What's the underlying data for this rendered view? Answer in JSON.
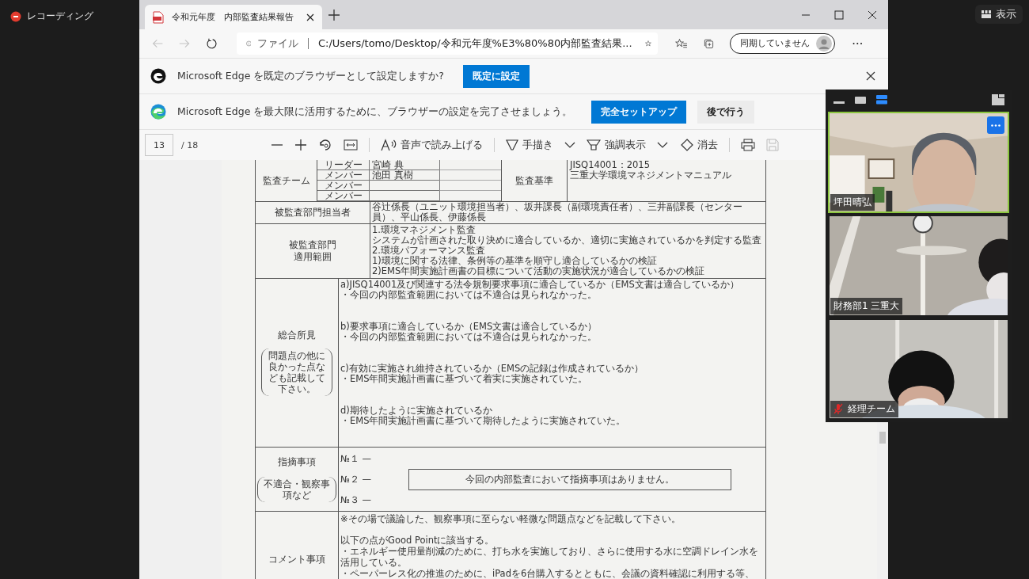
{
  "recording": {
    "label": "レコーディング"
  },
  "view_button": {
    "label": "表示"
  },
  "browser": {
    "tabs": [
      {
        "title": "令和元年度　内部監査結果報告",
        "selected": true
      }
    ],
    "nav_buttons": [
      {
        "kind": "back",
        "disabled": true
      },
      {
        "kind": "forward",
        "disabled": true
      },
      {
        "kind": "refresh",
        "disabled": false
      }
    ],
    "address": {
      "scheme": "ファイル",
      "url": "C:/Users/tomo/Desktop/令和元年度%E3%80%80内部監査結果..."
    },
    "profile": {
      "label": "同期していません"
    },
    "infobars": [
      {
        "message": "Microsoft Edge を既定のブラウザーとして設定しますか?",
        "buttons": [
          {
            "label": "既定に設定",
            "kind": "primary"
          }
        ],
        "closable": true
      },
      {
        "message": "Microsoft Edge を最大限に活用するために、ブラウザーの設定を完了させましょう。",
        "buttons": [
          {
            "label": "完全セットアップ",
            "kind": "primary"
          },
          {
            "label": "後で行う",
            "kind": "secondary"
          }
        ]
      }
    ],
    "pdf_toolbar": {
      "page": "13",
      "total": "/ 18",
      "read_aloud": "音声で読み上げる",
      "draw": "手描き",
      "highlight": "強調表示",
      "erase": "消去"
    }
  },
  "document": {
    "team": {
      "label": "監査チーム",
      "members": [
        {
          "role": "リーダー",
          "name": "宮崎 典"
        },
        {
          "role": "メンバー",
          "name": "池田 真樹"
        },
        {
          "role": "メンバー"
        },
        {
          "role": "メンバー"
        }
      ],
      "criteria_label": "監査基準",
      "criteria": [
        "JISQ14001：2015",
        "三重大学環境マネジメントマニュアル"
      ]
    },
    "contacts": {
      "label": "被監査部門担当者",
      "text": "谷辻係長（ユニット環境担当者）、坂井課長（副環境責任者）、三井副課長（センター員）、平山係長、伊藤係長"
    },
    "scope": {
      "label": [
        "被監査部門",
        "適用範囲"
      ],
      "lines": [
        "1.環境マネジメント監査",
        "システムが計画された取り決めに適合しているか、適切に実施されているかを判定する監査",
        "2.環境パフォーマンス監査",
        "1)環境に関する法律、条例等の基準を順守し適合しているかの検証",
        "2)EMS年間実施計画書の目標について活動の実施状況が適合しているかの検証"
      ]
    },
    "findings": {
      "label": "総合所見",
      "note": "問題点の他に良かった点なども記載して下さい。",
      "items": [
        {
          "heading": "a)JISQ14001及び関連する法令規制要求事項に適合しているか（EMS文書は適合しているか）",
          "result": "・今回の内部監査範囲においては不適合は見られなかった。"
        },
        {
          "heading": "b)要求事項に適合しているか（EMS文書は適合しているか）",
          "result": "・今回の内部監査範囲においては不適合は見られなかった。"
        },
        {
          "heading": "c)有効に実施され維持されているか（EMSの記録は作成されているか）",
          "result": "・EMS年間実施計画書に基づいて着実に実施されていた。"
        },
        {
          "heading": "d)期待したように実施されているか",
          "result": "・EMS年間実施計画書に基づいて期待したように実施されていた。"
        }
      ]
    },
    "issues": {
      "label": "指摘事項",
      "note": "不適合・観察事項など",
      "numbers": [
        "№１ —",
        "№２ —",
        "№３ —"
      ],
      "statement": "今回の内部監査において指摘事項はありません。"
    },
    "comments": {
      "label": "コメント事項",
      "lines": [
        "※その場で議論した、観察事項に至らない軽微な問題点などを記載して下さい。",
        "以下の点がGood Pointに該当する。",
        "・エネルギー使用量削減のために、打ち水を実施しており、さらに使用する水に空調ドレイン水を活用している。",
        "・ペーパーレス化の推進のために、iPadを6台購入するとともに、会議の資料確認に利用する等、"
      ]
    }
  },
  "meeting": {
    "view_modes": [
      {
        "kind": "minimize",
        "selected": false
      },
      {
        "kind": "speaker",
        "selected": false
      },
      {
        "kind": "strip",
        "selected": true
      }
    ],
    "tiles": [
      {
        "name": "坪田晴弘",
        "speaking": true,
        "muted": false,
        "kind": "picture"
      },
      {
        "name": "財務部1 三重大",
        "speaking": false,
        "muted": false,
        "kind": "picture"
      },
      {
        "name": "経理チーム",
        "speaking": false,
        "muted": true,
        "kind": "picture"
      }
    ]
  }
}
